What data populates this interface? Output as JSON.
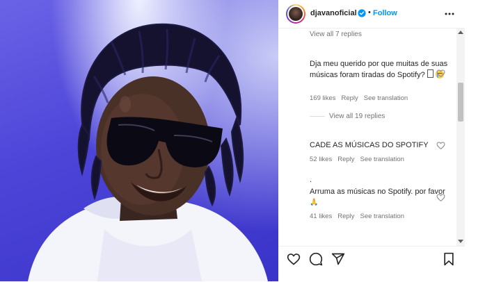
{
  "post": {
    "author": {
      "username": "djavanoficial",
      "verified": true,
      "follow_label": "Follow",
      "separator": "•"
    }
  },
  "comments": [
    {
      "type": "view_replies",
      "label": "View all 7 replies"
    },
    {
      "type": "comment",
      "text": "Dja meu querido por que muitas de suas músicas foram tiradas do Spotify?",
      "emoji": [
        "unknown-glyph-box",
        "crying-face"
      ],
      "likes": "169 likes",
      "reply_label": "Reply",
      "translate_label": "See translation"
    },
    {
      "type": "view_replies",
      "label": "View all 19 replies"
    },
    {
      "type": "comment",
      "text": "CADE AS MÚSICAS DO SPOTIFY",
      "likes": "52 likes",
      "reply_label": "Reply",
      "translate_label": "See translation"
    },
    {
      "type": "comment",
      "text_prefix": ".",
      "text": "Arruma as músicas no Spotify. por favor",
      "emoji": [
        "folded-hands"
      ],
      "likes": "41 likes",
      "reply_label": "Reply",
      "translate_label": "See translation"
    }
  ],
  "icons": {
    "more": "more-horizontal-icon",
    "heart": "heart-outline-icon",
    "like": "heart-outline-icon",
    "comment": "comment-bubble-icon",
    "share": "paper-plane-icon",
    "save": "bookmark-icon",
    "verified": "verified-badge-icon"
  },
  "colors": {
    "follow": "#0095f6",
    "verified": "#0095f6",
    "text_primary": "#262626",
    "text_secondary": "#737373",
    "photo_background": "#4d45d8"
  }
}
